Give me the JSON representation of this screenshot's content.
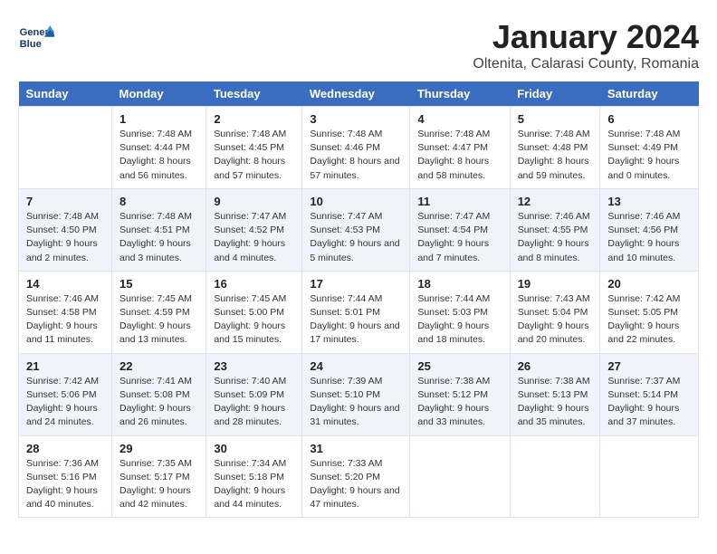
{
  "header": {
    "logo_line1": "General",
    "logo_line2": "Blue",
    "title": "January 2024",
    "subtitle": "Oltenita, Calarasi County, Romania"
  },
  "days_of_week": [
    "Sunday",
    "Monday",
    "Tuesday",
    "Wednesday",
    "Thursday",
    "Friday",
    "Saturday"
  ],
  "weeks": [
    [
      {
        "date": "",
        "sunrise": "",
        "sunset": "",
        "daylight": ""
      },
      {
        "date": "1",
        "sunrise": "Sunrise: 7:48 AM",
        "sunset": "Sunset: 4:44 PM",
        "daylight": "Daylight: 8 hours and 56 minutes."
      },
      {
        "date": "2",
        "sunrise": "Sunrise: 7:48 AM",
        "sunset": "Sunset: 4:45 PM",
        "daylight": "Daylight: 8 hours and 57 minutes."
      },
      {
        "date": "3",
        "sunrise": "Sunrise: 7:48 AM",
        "sunset": "Sunset: 4:46 PM",
        "daylight": "Daylight: 8 hours and 57 minutes."
      },
      {
        "date": "4",
        "sunrise": "Sunrise: 7:48 AM",
        "sunset": "Sunset: 4:47 PM",
        "daylight": "Daylight: 8 hours and 58 minutes."
      },
      {
        "date": "5",
        "sunrise": "Sunrise: 7:48 AM",
        "sunset": "Sunset: 4:48 PM",
        "daylight": "Daylight: 8 hours and 59 minutes."
      },
      {
        "date": "6",
        "sunrise": "Sunrise: 7:48 AM",
        "sunset": "Sunset: 4:49 PM",
        "daylight": "Daylight: 9 hours and 0 minutes."
      }
    ],
    [
      {
        "date": "7",
        "sunrise": "Sunrise: 7:48 AM",
        "sunset": "Sunset: 4:50 PM",
        "daylight": "Daylight: 9 hours and 2 minutes."
      },
      {
        "date": "8",
        "sunrise": "Sunrise: 7:48 AM",
        "sunset": "Sunset: 4:51 PM",
        "daylight": "Daylight: 9 hours and 3 minutes."
      },
      {
        "date": "9",
        "sunrise": "Sunrise: 7:47 AM",
        "sunset": "Sunset: 4:52 PM",
        "daylight": "Daylight: 9 hours and 4 minutes."
      },
      {
        "date": "10",
        "sunrise": "Sunrise: 7:47 AM",
        "sunset": "Sunset: 4:53 PM",
        "daylight": "Daylight: 9 hours and 5 minutes."
      },
      {
        "date": "11",
        "sunrise": "Sunrise: 7:47 AM",
        "sunset": "Sunset: 4:54 PM",
        "daylight": "Daylight: 9 hours and 7 minutes."
      },
      {
        "date": "12",
        "sunrise": "Sunrise: 7:46 AM",
        "sunset": "Sunset: 4:55 PM",
        "daylight": "Daylight: 9 hours and 8 minutes."
      },
      {
        "date": "13",
        "sunrise": "Sunrise: 7:46 AM",
        "sunset": "Sunset: 4:56 PM",
        "daylight": "Daylight: 9 hours and 10 minutes."
      }
    ],
    [
      {
        "date": "14",
        "sunrise": "Sunrise: 7:46 AM",
        "sunset": "Sunset: 4:58 PM",
        "daylight": "Daylight: 9 hours and 11 minutes."
      },
      {
        "date": "15",
        "sunrise": "Sunrise: 7:45 AM",
        "sunset": "Sunset: 4:59 PM",
        "daylight": "Daylight: 9 hours and 13 minutes."
      },
      {
        "date": "16",
        "sunrise": "Sunrise: 7:45 AM",
        "sunset": "Sunset: 5:00 PM",
        "daylight": "Daylight: 9 hours and 15 minutes."
      },
      {
        "date": "17",
        "sunrise": "Sunrise: 7:44 AM",
        "sunset": "Sunset: 5:01 PM",
        "daylight": "Daylight: 9 hours and 17 minutes."
      },
      {
        "date": "18",
        "sunrise": "Sunrise: 7:44 AM",
        "sunset": "Sunset: 5:03 PM",
        "daylight": "Daylight: 9 hours and 18 minutes."
      },
      {
        "date": "19",
        "sunrise": "Sunrise: 7:43 AM",
        "sunset": "Sunset: 5:04 PM",
        "daylight": "Daylight: 9 hours and 20 minutes."
      },
      {
        "date": "20",
        "sunrise": "Sunrise: 7:42 AM",
        "sunset": "Sunset: 5:05 PM",
        "daylight": "Daylight: 9 hours and 22 minutes."
      }
    ],
    [
      {
        "date": "21",
        "sunrise": "Sunrise: 7:42 AM",
        "sunset": "Sunset: 5:06 PM",
        "daylight": "Daylight: 9 hours and 24 minutes."
      },
      {
        "date": "22",
        "sunrise": "Sunrise: 7:41 AM",
        "sunset": "Sunset: 5:08 PM",
        "daylight": "Daylight: 9 hours and 26 minutes."
      },
      {
        "date": "23",
        "sunrise": "Sunrise: 7:40 AM",
        "sunset": "Sunset: 5:09 PM",
        "daylight": "Daylight: 9 hours and 28 minutes."
      },
      {
        "date": "24",
        "sunrise": "Sunrise: 7:39 AM",
        "sunset": "Sunset: 5:10 PM",
        "daylight": "Daylight: 9 hours and 31 minutes."
      },
      {
        "date": "25",
        "sunrise": "Sunrise: 7:38 AM",
        "sunset": "Sunset: 5:12 PM",
        "daylight": "Daylight: 9 hours and 33 minutes."
      },
      {
        "date": "26",
        "sunrise": "Sunrise: 7:38 AM",
        "sunset": "Sunset: 5:13 PM",
        "daylight": "Daylight: 9 hours and 35 minutes."
      },
      {
        "date": "27",
        "sunrise": "Sunrise: 7:37 AM",
        "sunset": "Sunset: 5:14 PM",
        "daylight": "Daylight: 9 hours and 37 minutes."
      }
    ],
    [
      {
        "date": "28",
        "sunrise": "Sunrise: 7:36 AM",
        "sunset": "Sunset: 5:16 PM",
        "daylight": "Daylight: 9 hours and 40 minutes."
      },
      {
        "date": "29",
        "sunrise": "Sunrise: 7:35 AM",
        "sunset": "Sunset: 5:17 PM",
        "daylight": "Daylight: 9 hours and 42 minutes."
      },
      {
        "date": "30",
        "sunrise": "Sunrise: 7:34 AM",
        "sunset": "Sunset: 5:18 PM",
        "daylight": "Daylight: 9 hours and 44 minutes."
      },
      {
        "date": "31",
        "sunrise": "Sunrise: 7:33 AM",
        "sunset": "Sunset: 5:20 PM",
        "daylight": "Daylight: 9 hours and 47 minutes."
      },
      {
        "date": "",
        "sunrise": "",
        "sunset": "",
        "daylight": ""
      },
      {
        "date": "",
        "sunrise": "",
        "sunset": "",
        "daylight": ""
      },
      {
        "date": "",
        "sunrise": "",
        "sunset": "",
        "daylight": ""
      }
    ]
  ]
}
